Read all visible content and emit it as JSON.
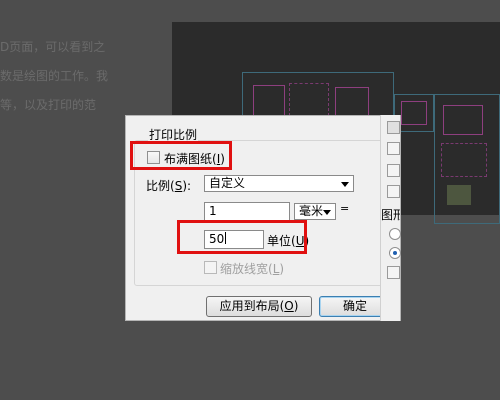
{
  "background": {
    "doc_lines": [
      "D页面，可以看到之",
      "数是绘图的工作。我",
      "等，以及打印的范"
    ]
  },
  "dialog": {
    "group_title": "打印比例",
    "fit_paper": {
      "label": "布满图纸",
      "accel": "I",
      "checked": false
    },
    "scale": {
      "label": "比例",
      "accel": "S",
      "value": "自定义"
    },
    "paper_value": "1",
    "unit": {
      "value": "毫米"
    },
    "equals": "=",
    "drawing_units": {
      "value": "50",
      "label": "单位",
      "accel": "U"
    },
    "scale_lineweights": {
      "label": "缩放线宽",
      "accel": "L",
      "checked": false,
      "enabled": false
    },
    "apply_button": {
      "label": "应用到布局",
      "accel": "O"
    },
    "ok_button": {
      "label": "确定"
    },
    "side_label": "图形"
  },
  "highlight_color": "#e01010"
}
